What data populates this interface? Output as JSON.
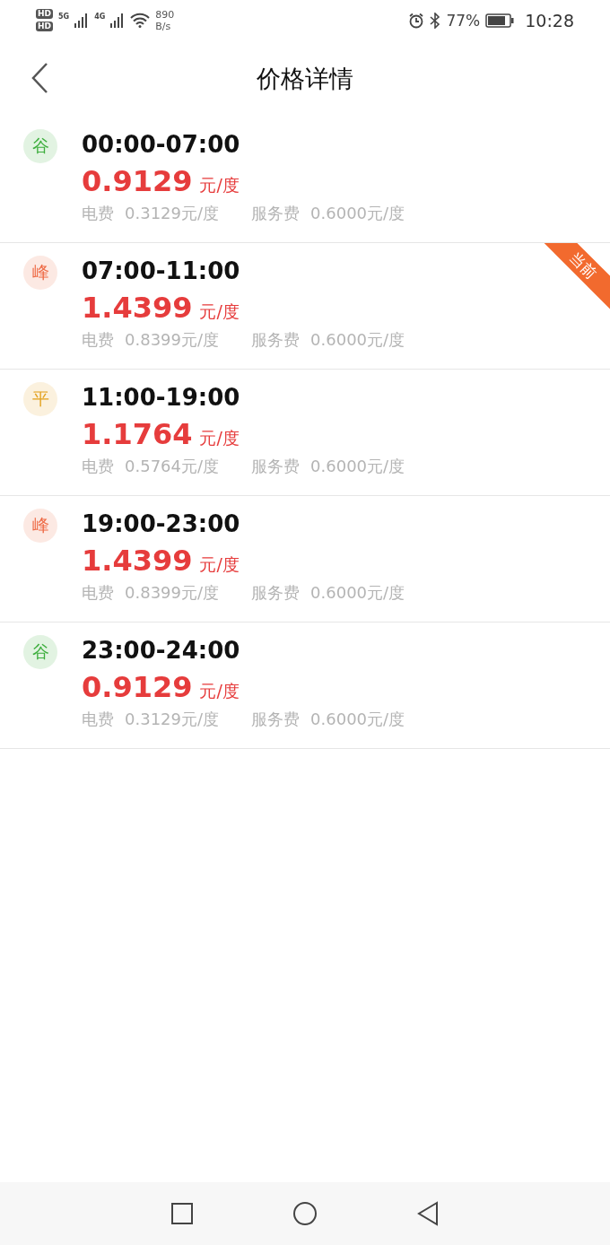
{
  "status_bar": {
    "sim_badges": [
      "HD",
      "HD"
    ],
    "networks": [
      "5G",
      "4G"
    ],
    "speed_value": "890",
    "speed_unit": "B/s",
    "battery": "77%",
    "time": "10:28"
  },
  "header": {
    "title": "价格详情"
  },
  "current_label": "当前",
  "periods": [
    {
      "badge": "谷",
      "color": "#3dae3d",
      "time": "00:00-07:00",
      "price": "0.9129",
      "unit": "元/度",
      "electricity_label": "电费",
      "electricity": "0.3129元/度",
      "service_label": "服务费",
      "service": "0.6000元/度",
      "current": false
    },
    {
      "badge": "峰",
      "color": "#ee6a45",
      "time": "07:00-11:00",
      "price": "1.4399",
      "unit": "元/度",
      "electricity_label": "电费",
      "electricity": "0.8399元/度",
      "service_label": "服务费",
      "service": "0.6000元/度",
      "current": true
    },
    {
      "badge": "平",
      "color": "#e3a21f",
      "time": "11:00-19:00",
      "price": "1.1764",
      "unit": "元/度",
      "electricity_label": "电费",
      "electricity": "0.5764元/度",
      "service_label": "服务费",
      "service": "0.6000元/度",
      "current": false
    },
    {
      "badge": "峰",
      "color": "#ee6a45",
      "time": "19:00-23:00",
      "price": "1.4399",
      "unit": "元/度",
      "electricity_label": "电费",
      "electricity": "0.8399元/度",
      "service_label": "服务费",
      "service": "0.6000元/度",
      "current": false
    },
    {
      "badge": "谷",
      "color": "#3dae3d",
      "time": "23:00-24:00",
      "price": "0.9129",
      "unit": "元/度",
      "electricity_label": "电费",
      "electricity": "0.3129元/度",
      "service_label": "服务费",
      "service": "0.6000元/度",
      "current": false
    }
  ]
}
